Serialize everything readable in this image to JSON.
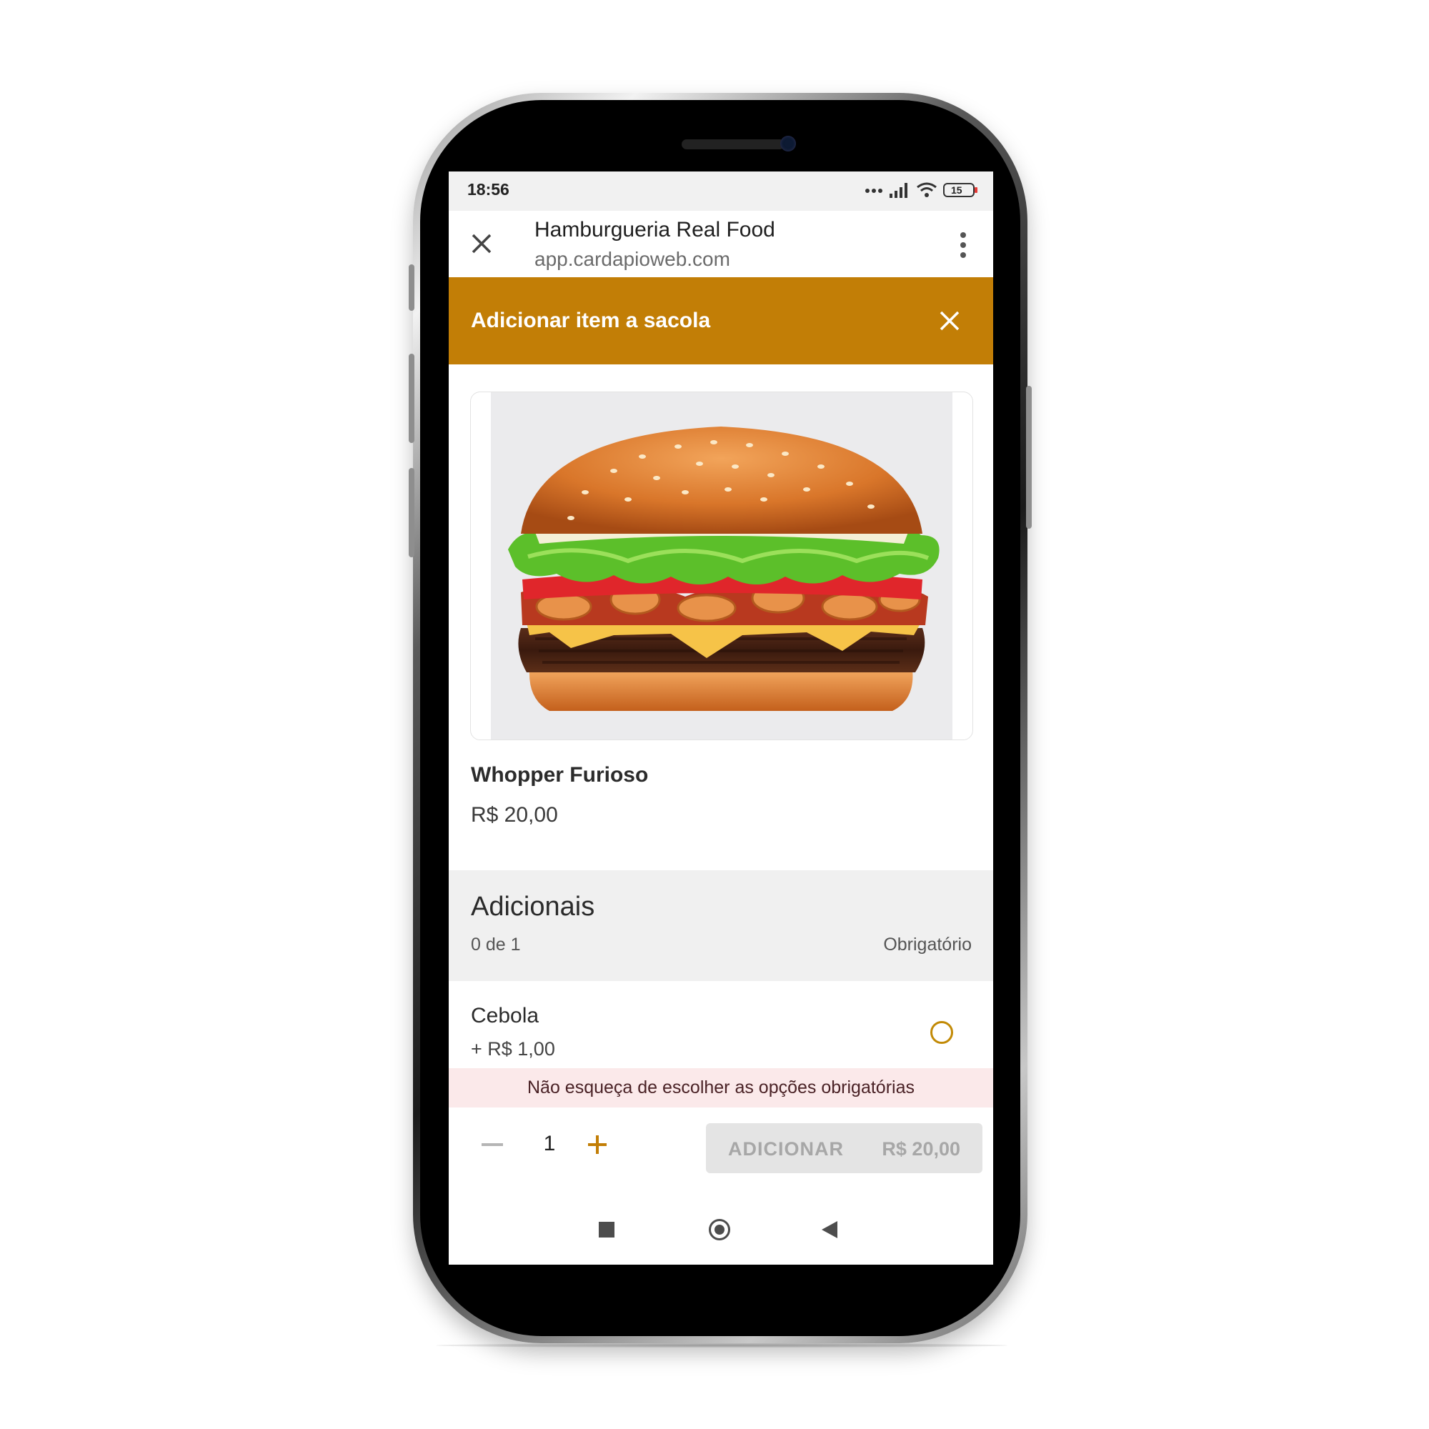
{
  "status_bar": {
    "time": "18:56",
    "battery_level": "15",
    "icons": [
      "dots-icon",
      "signal-icon",
      "wifi-icon",
      "battery-icon"
    ]
  },
  "browser": {
    "title": "Hamburgueria Real Food",
    "url": "app.cardapioweb.com",
    "close_icon": "close-icon",
    "menu_icon": "more-vert-icon"
  },
  "modal": {
    "title": "Adicionar item a sacola",
    "accent_color": "#c27e06",
    "close_icon": "close-icon"
  },
  "product": {
    "image": "burger-photo",
    "name": "Whopper Furioso",
    "price": "R$ 20,00"
  },
  "addons_group": {
    "title": "Adicionais",
    "count": "0 de 1",
    "required_label": "Obrigatório",
    "options": [
      {
        "name": "Cebola",
        "price": "+ R$ 1,00",
        "selected": false
      }
    ]
  },
  "warning": {
    "text": "Não esqueça de escolher as opções obrigatórias",
    "background": "#fbe9ea"
  },
  "order_bar": {
    "quantity": "1",
    "minus_icon": "minus-icon",
    "plus_icon": "plus-icon",
    "add_label": "ADICIONAR",
    "add_price": "R$ 20,00",
    "add_enabled": false
  },
  "nav_bar": {
    "icons": [
      "recent-apps-icon",
      "home-icon",
      "back-icon"
    ]
  }
}
